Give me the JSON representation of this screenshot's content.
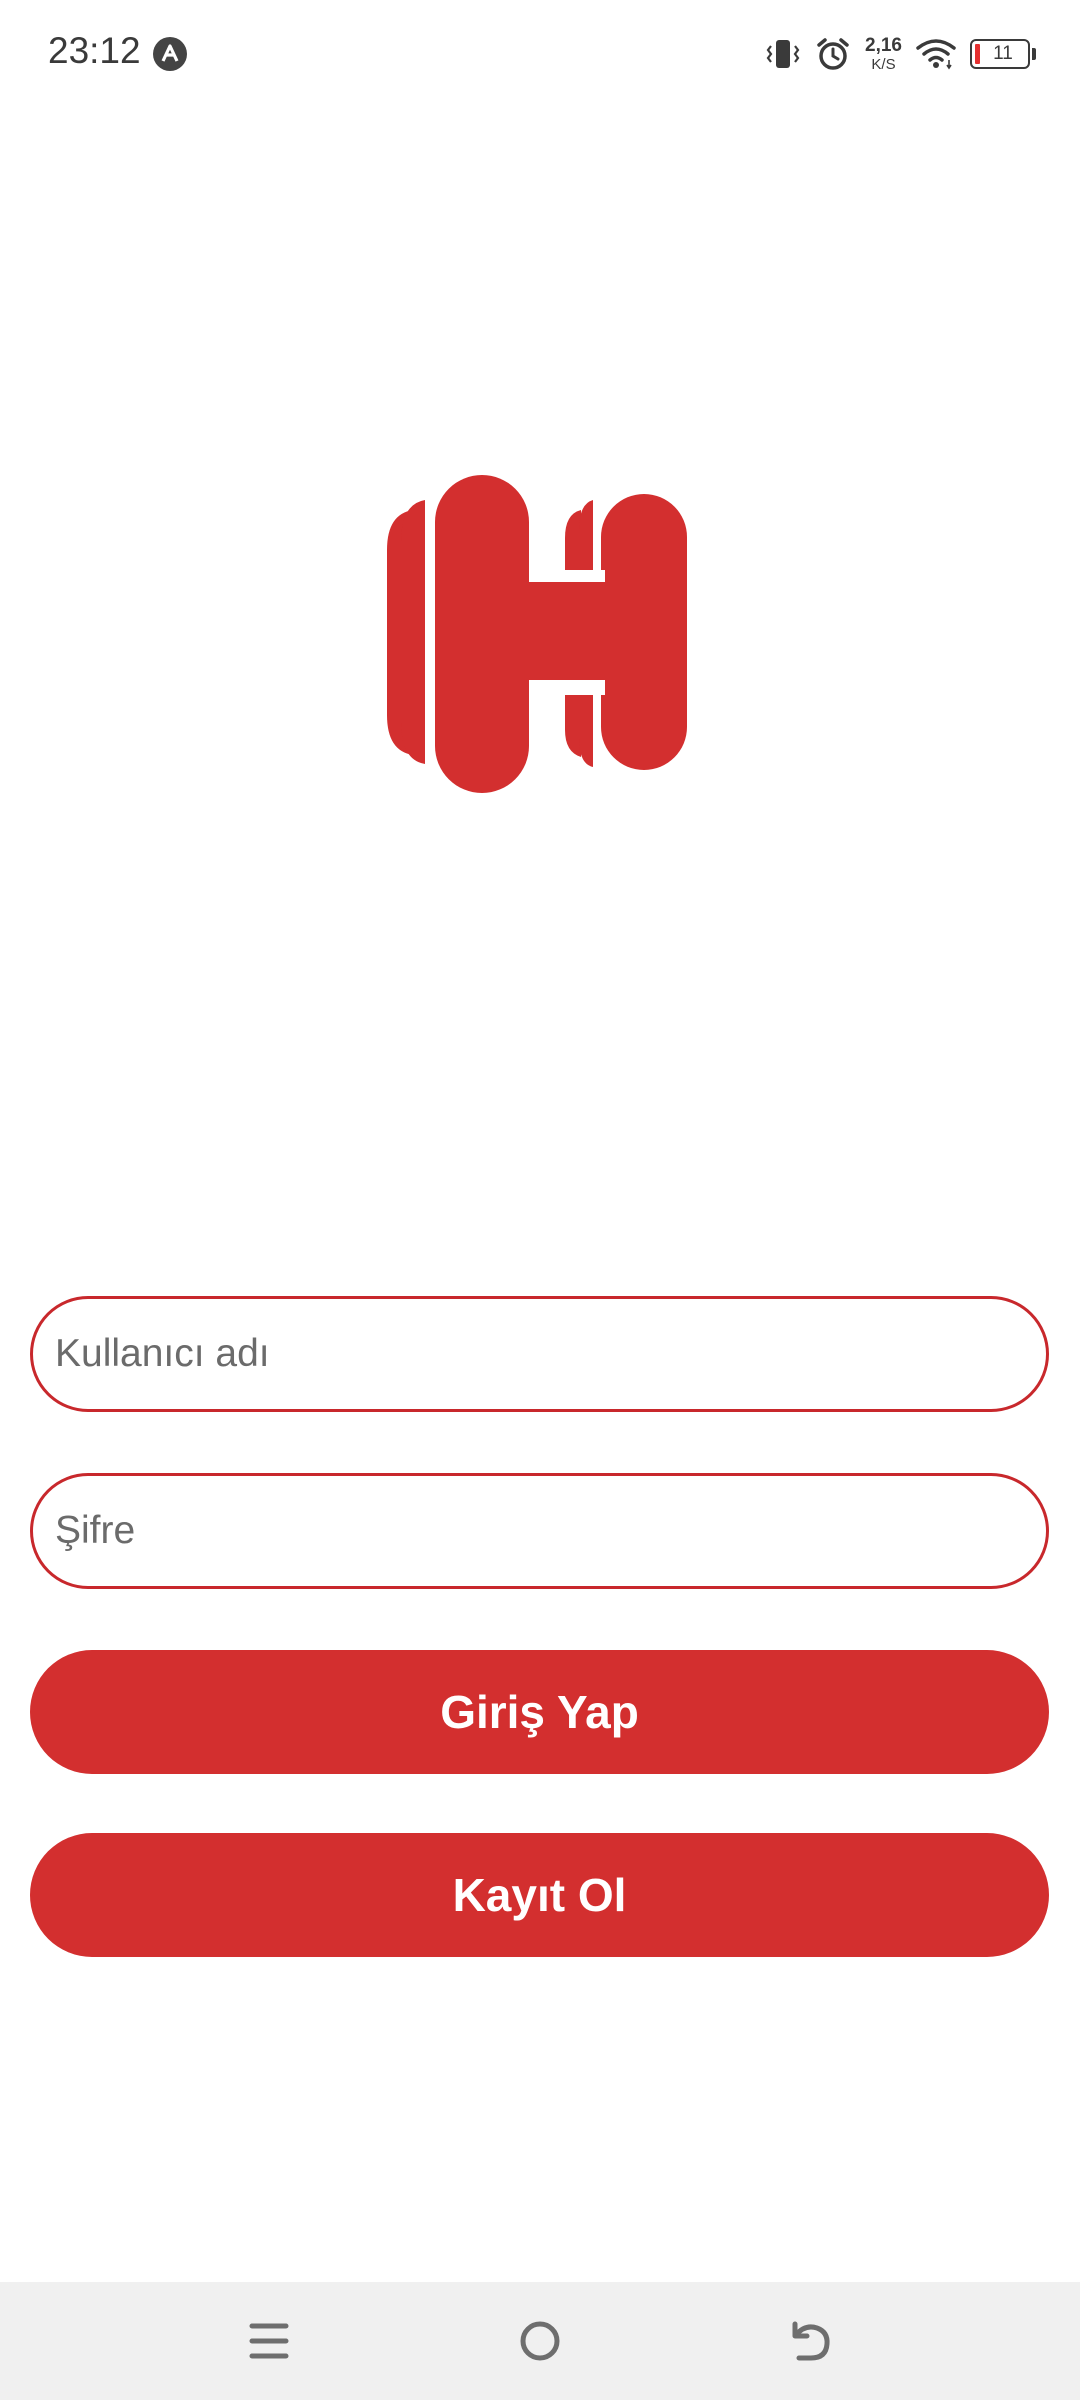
{
  "status_bar": {
    "time": "23:12",
    "net_speed_value": "2,16",
    "net_speed_unit": "K/S",
    "battery_level": "11",
    "battery_fraction": 0.11,
    "icons": [
      "app-notification-icon",
      "vibrate-icon",
      "alarm-icon",
      "wifi-icon",
      "battery-icon"
    ]
  },
  "logo": {
    "icon": "hotels-h-logo",
    "color": "#d32f2f"
  },
  "form": {
    "username_placeholder": "Kullanıcı adı",
    "password_placeholder": "Şifre",
    "login_label": "Giriş Yap",
    "register_label": "Kayıt Ol",
    "accent_color": "#d32f2f"
  },
  "nav_bar": {
    "icons": [
      "menu-icon",
      "home-icon",
      "back-icon"
    ]
  }
}
